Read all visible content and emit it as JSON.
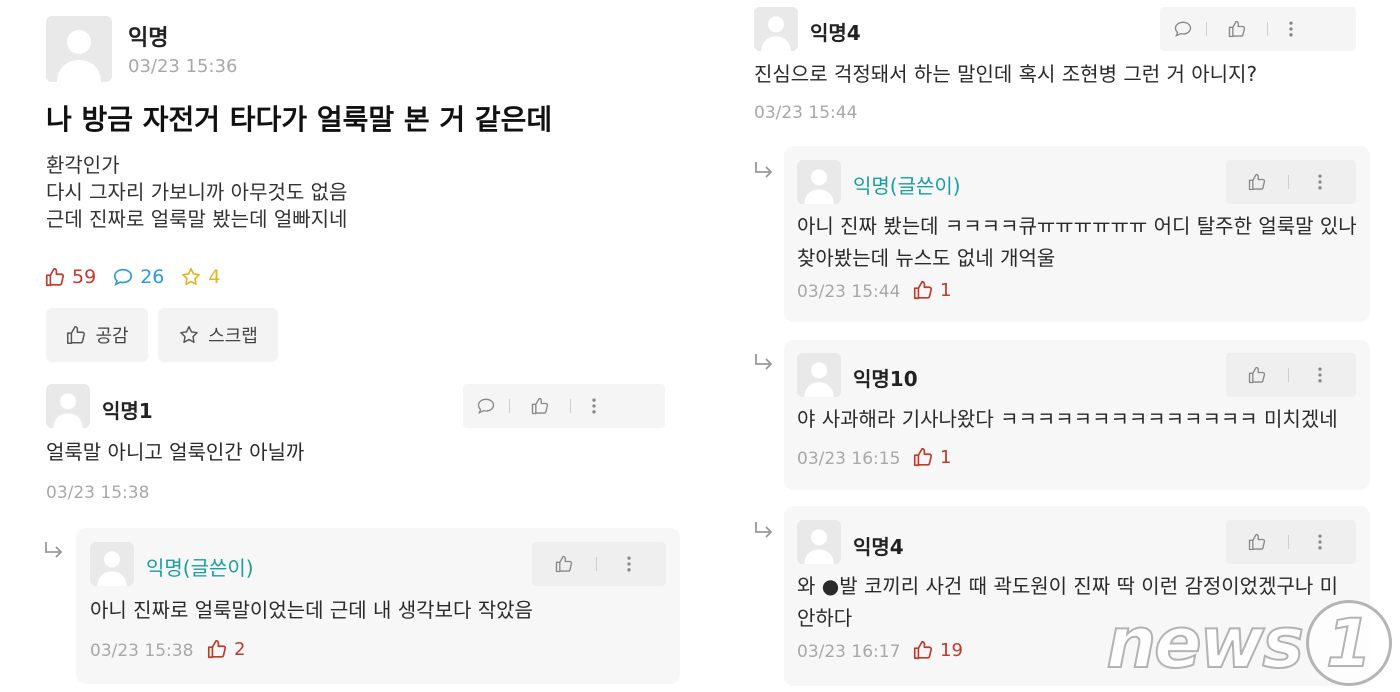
{
  "post": {
    "author": "익명",
    "time": "03/23 15:36",
    "title": "나 방금 자전거 타다가 얼룩말 본 거 같은데",
    "body": [
      "환각인가",
      "다시 그자리 가보니까 아무것도 없음",
      "근데 진짜로 얼룩말 봤는데 얼빠지네"
    ],
    "likes": "59",
    "comments": "26",
    "scraps": "4",
    "like_button": "공감",
    "scrap_button": "스크랩"
  },
  "comments": [
    {
      "author": "익명1",
      "text": "얼룩말 아니고 얼룩인간 아닐까",
      "time": "03/23 15:38"
    },
    {
      "author": "익명(글쓴이)",
      "text": "아니 진짜로 얼룩말이었는데 근데 내 생각보다 작았음",
      "time": "03/23 15:38",
      "likes": "2"
    },
    {
      "author": "익명4",
      "text": "진심으로 걱정돼서 하는 말인데 혹시 조현병 그런 거 아니지?",
      "time": "03/23 15:44"
    },
    {
      "author": "익명(글쓴이)",
      "lines": [
        "아니 진짜 봤는데 ㅋㅋㅋㅋ큐ㅠㅠㅠㅠㅠㅠ 어디 탈주한 얼룩말 있나",
        "찾아봤는데 뉴스도 없네 개억울"
      ],
      "time": "03/23 15:44",
      "likes": "1"
    },
    {
      "author": "익명10",
      "text": "야 사과해라 기사나왔다 ㅋㅋㅋㅋㅋㅋㅋㅋㅋㅋㅋㅋㅋㅋ 미치겠네",
      "time": "03/23 16:15",
      "likes": "1"
    },
    {
      "author": "익명4",
      "lines": [
        "와 ●발 코끼리 사건 때 곽도원이 진짜 딱 이런 감정이었겠구나 미",
        "안하다"
      ],
      "time": "03/23 16:17",
      "likes": "19"
    }
  ],
  "watermark": {
    "text": "news",
    "mark": "1"
  },
  "colors": {
    "author": "#1a9e9e",
    "like": "#c0392b",
    "comment": "#2a9bd6",
    "scrap": "#e6b422",
    "meta": "#a8a8a8"
  },
  "icons": [
    "avatar-icon",
    "thumbs-up-icon",
    "speech-bubble-icon",
    "star-icon",
    "more-vertical-icon",
    "reply-arrow-icon"
  ]
}
